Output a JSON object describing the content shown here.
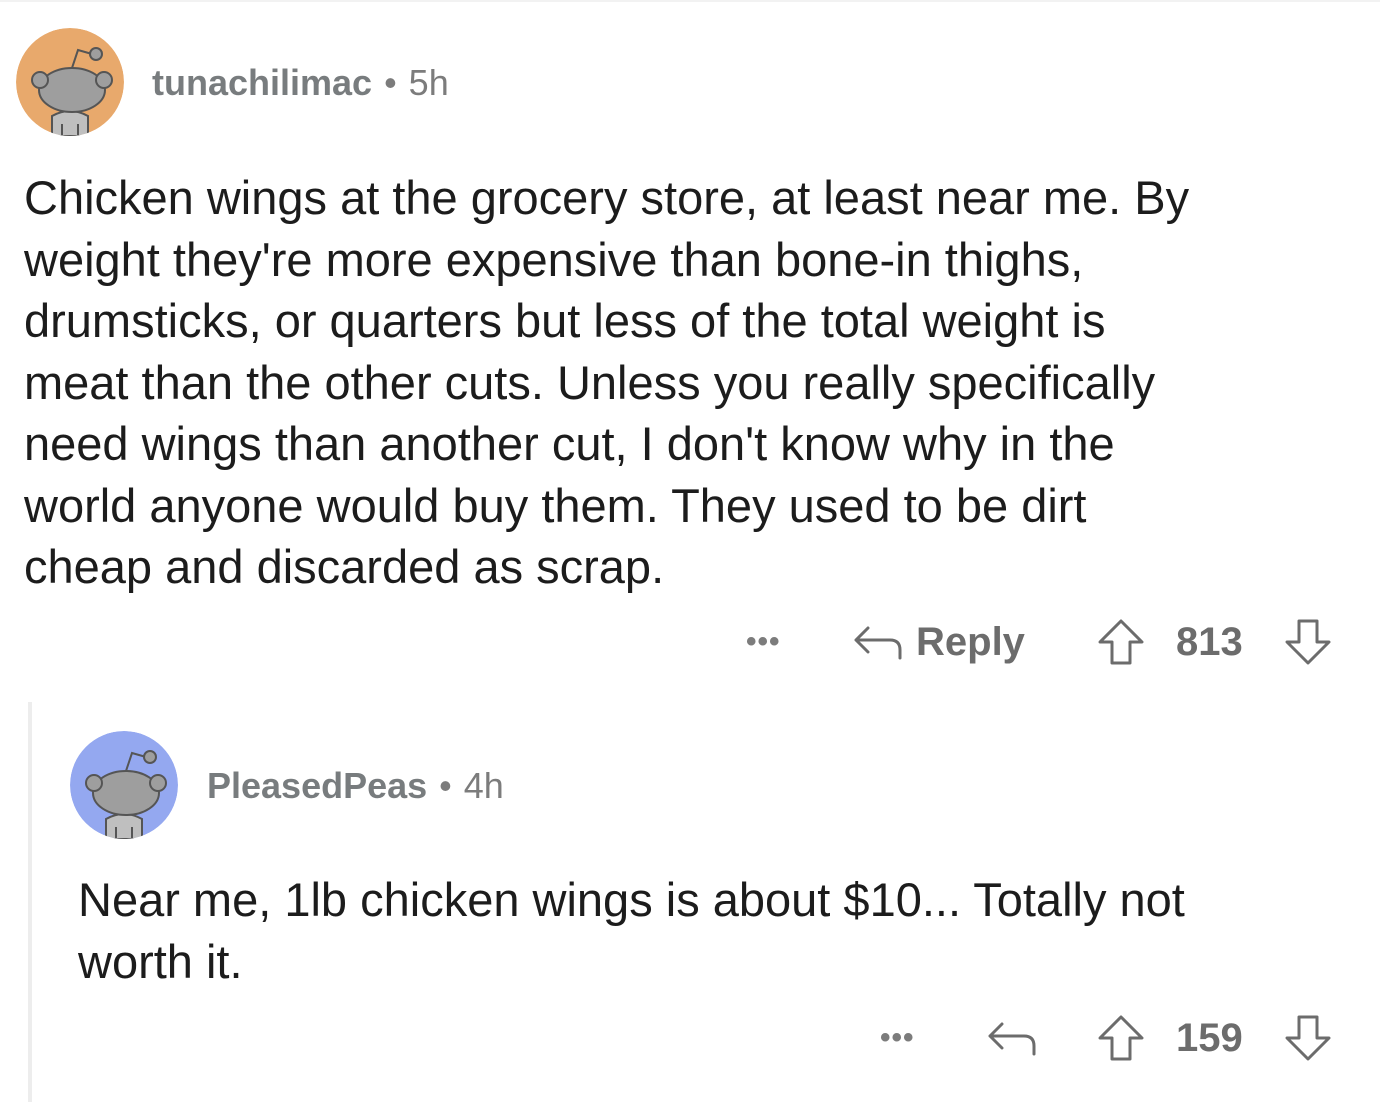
{
  "comments": [
    {
      "username": "tunachilimac",
      "separator": "•",
      "time": "5h",
      "avatar_color": "#e8a96c",
      "avatar_icon": "snoo-avatar-icon",
      "lines": [
        "Chicken wings at the grocery store, at least near me. By",
        "weight they're more expensive than bone-in thighs,",
        "drumsticks, or quarters but less of the total weight is",
        "meat than the other cuts. Unless you really specifically",
        "need wings than another cut, I don't know why in the",
        "world anyone would buy them. They used to be dirt",
        "cheap and discarded as scrap."
      ],
      "more": "•••",
      "reply_label": "Reply",
      "score": "813"
    },
    {
      "username": "PleasedPeas",
      "separator": "•",
      "time": "4h",
      "avatar_color": "#94a8f0",
      "avatar_icon": "snoo-avatar-icon",
      "lines": [
        "Near me, 1lb chicken wings is about $10... Totally not",
        "worth it."
      ],
      "more": "•••",
      "reply_label": "",
      "score": "159"
    }
  ]
}
